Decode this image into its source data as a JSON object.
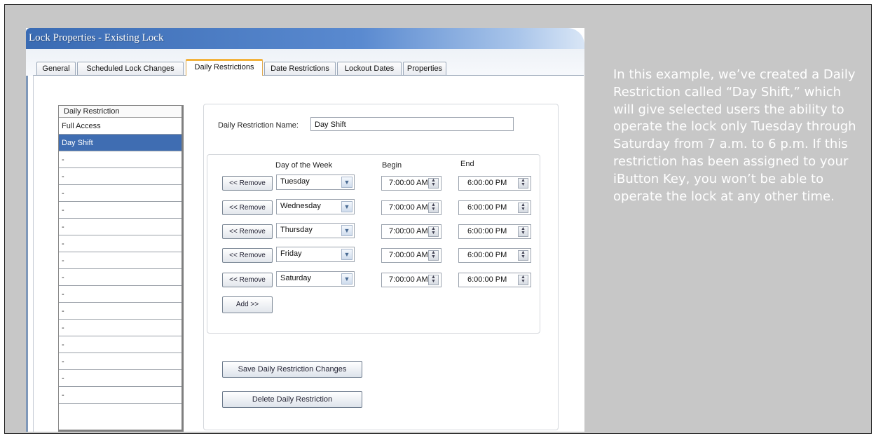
{
  "window": {
    "title": "Lock Properties - Existing Lock"
  },
  "tabs": [
    {
      "label": "General",
      "active": false
    },
    {
      "label": "Scheduled Lock Changes",
      "active": false
    },
    {
      "label": "Daily Restrictions",
      "active": true
    },
    {
      "label": "Date Restrictions",
      "active": false
    },
    {
      "label": "Lockout Dates",
      "active": false
    },
    {
      "label": "Properties",
      "active": false
    }
  ],
  "restriction_list": {
    "header": "Daily Restriction",
    "items": [
      "Full Access",
      "Day Shift",
      "-",
      "-",
      "-",
      "-",
      "-",
      "-",
      "-",
      "-",
      "-",
      "-",
      "-",
      "-",
      "-",
      "-",
      "-"
    ],
    "selected": "Day Shift"
  },
  "form": {
    "name_label": "Daily Restriction Name:",
    "name_value": "Day Shift",
    "col_day": "Day of the Week",
    "col_begin": "Begin",
    "col_end": "End",
    "remove_label": "<< Remove",
    "add_label": "Add >>",
    "save_label": "Save Daily Restriction Changes",
    "delete_label": "Delete Daily Restriction",
    "rows": [
      {
        "day": "Tuesday",
        "begin": "7:00:00 AM",
        "end": "6:00:00 PM"
      },
      {
        "day": "Wednesday",
        "begin": "7:00:00 AM",
        "end": "6:00:00 PM"
      },
      {
        "day": "Thursday",
        "begin": "7:00:00 AM",
        "end": "6:00:00 PM"
      },
      {
        "day": "Friday",
        "begin": "7:00:00 AM",
        "end": "6:00:00 PM"
      },
      {
        "day": "Saturday",
        "begin": "7:00:00 AM",
        "end": "6:00:00 PM"
      }
    ]
  },
  "caption": "In this example, we’ve created a Daily Restriction called “Day Shift,” which will give selected users the ability to operate the lock only Tuesday through Saturday from 7 a.m. to 6 p.m. If this restriction has been assigned to your iButton Key, you won’t be able to operate the lock at any other time.",
  "icons": {
    "dropdown": "chevron-down-icon",
    "spinner": "spin-updown-icon"
  },
  "colors": {
    "title_bar": "#3a6bb3",
    "selected_row": "#3f6db2",
    "active_tab_accent": "#f2b23c",
    "background": "#c7c7c7"
  }
}
